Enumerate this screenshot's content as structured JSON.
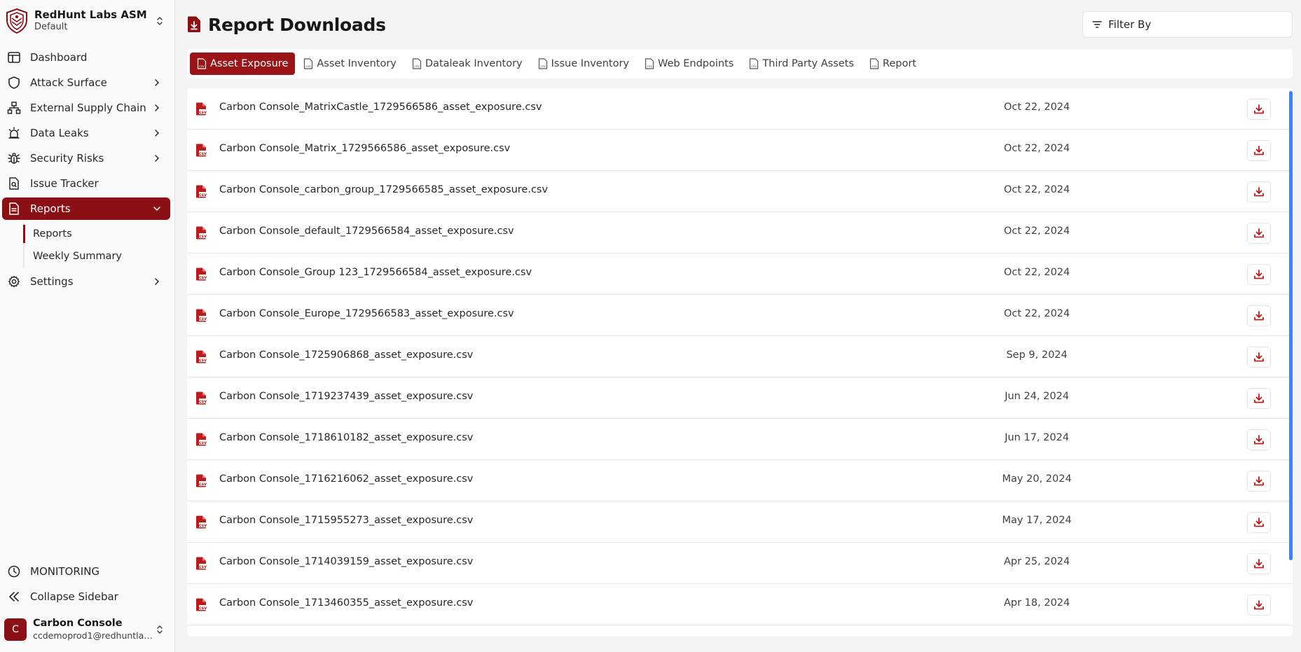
{
  "brand": {
    "title": "RedHunt Labs ASM",
    "subtitle": "Default"
  },
  "nav": [
    {
      "label": "Dashboard",
      "icon": "layout-icon"
    },
    {
      "label": "Attack Surface",
      "icon": "shield-icon"
    },
    {
      "label": "External Supply Chain",
      "icon": "network-icon"
    },
    {
      "label": "Data Leaks",
      "icon": "alarm-icon"
    },
    {
      "label": "Security Risks",
      "icon": "bug-icon"
    },
    {
      "label": "Issue Tracker",
      "icon": "file-search-icon"
    },
    {
      "label": "Reports",
      "icon": "file-text-icon"
    },
    {
      "label": "Settings",
      "icon": "gear-icon"
    }
  ],
  "reports_sub": [
    "Reports",
    "Weekly Summary"
  ],
  "bottom": {
    "monitoring": "MONITORING",
    "collapse": "Collapse Sidebar"
  },
  "user": {
    "initial": "C",
    "name": "Carbon Console",
    "email": "ccdemoprod1@redhuntlabs.com"
  },
  "page": {
    "title": "Report Downloads",
    "filter": "Filter By"
  },
  "tabs": [
    "Asset Exposure",
    "Asset Inventory",
    "Dataleak Inventory",
    "Issue Inventory",
    "Web Endpoints",
    "Third Party Assets",
    "Report"
  ],
  "files": [
    {
      "name": "Carbon Console_MatrixCastle_1729566586_asset_exposure.csv",
      "date": "Oct 22, 2024"
    },
    {
      "name": "Carbon Console_Matrix_1729566586_asset_exposure.csv",
      "date": "Oct 22, 2024"
    },
    {
      "name": "Carbon Console_carbon_group_1729566585_asset_exposure.csv",
      "date": "Oct 22, 2024"
    },
    {
      "name": "Carbon Console_default_1729566584_asset_exposure.csv",
      "date": "Oct 22, 2024"
    },
    {
      "name": "Carbon Console_Group 123_1729566584_asset_exposure.csv",
      "date": "Oct 22, 2024"
    },
    {
      "name": "Carbon Console_Europe_1729566583_asset_exposure.csv",
      "date": "Oct 22, 2024"
    },
    {
      "name": "Carbon Console_1725906868_asset_exposure.csv",
      "date": "Sep 9, 2024"
    },
    {
      "name": "Carbon Console_1719237439_asset_exposure.csv",
      "date": "Jun 24, 2024"
    },
    {
      "name": "Carbon Console_1718610182_asset_exposure.csv",
      "date": "Jun 17, 2024"
    },
    {
      "name": "Carbon Console_1716216062_asset_exposure.csv",
      "date": "May 20, 2024"
    },
    {
      "name": "Carbon Console_1715955273_asset_exposure.csv",
      "date": "May 17, 2024"
    },
    {
      "name": "Carbon Console_1714039159_asset_exposure.csv",
      "date": "Apr 25, 2024"
    },
    {
      "name": "Carbon Console_1713460355_asset_exposure.csv",
      "date": "Apr 18, 2024"
    }
  ],
  "colors": {
    "accent": "#8b1015",
    "tab_active": "#9a1418",
    "icon_red": "#b91c1c"
  }
}
